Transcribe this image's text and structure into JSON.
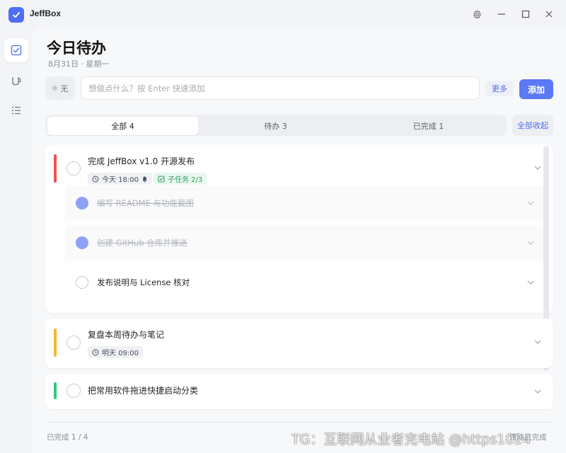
{
  "app": {
    "title": "JeffBox",
    "logo_icon": "check-icon",
    "accent": "#4f6df5"
  },
  "window_controls": [
    "settings-icon",
    "minimize-icon",
    "maximize-icon",
    "close-icon"
  ],
  "rail": {
    "items": [
      "tasks-icon",
      "cup-icon",
      "list-icon"
    ],
    "active": "tasks-icon"
  },
  "header": {
    "title": "今日待办",
    "subtitle": "8月31日 · 星期一"
  },
  "composer": {
    "priority_label": "无",
    "placeholder": "想做点什么？按 Enter 快速添加",
    "more_label": "更多",
    "add_label": "添加"
  },
  "tabs": [
    {
      "label": "全部 4",
      "active": true
    },
    {
      "label": "待办 3",
      "active": false
    },
    {
      "label": "已完成 1",
      "active": false
    }
  ],
  "collapse_label": "全部收起",
  "tasks": [
    {
      "title": "完成 JeffBox v1.0 开源发布",
      "color": "#ef5350",
      "due": "今天 18:00",
      "subtask_badge": "子任务 2/3",
      "subtasks": [
        {
          "title": "编写 README 与功能截图",
          "done": true
        },
        {
          "title": "创建 GitHub 仓库并推送",
          "done": true
        },
        {
          "title": "发布说明与 License 核对",
          "done": false
        }
      ]
    },
    {
      "title": "复盘本周待办与笔记",
      "color": "#f5b731",
      "due": "明天 09:00"
    },
    {
      "title": "把常用软件拖进快捷启动分类",
      "color": "#34c77b"
    }
  ],
  "footer": {
    "count": "已完成 1 / 4",
    "right": "清除已完成"
  },
  "watermark": "TG：互联网从业者充电站 @https1024"
}
